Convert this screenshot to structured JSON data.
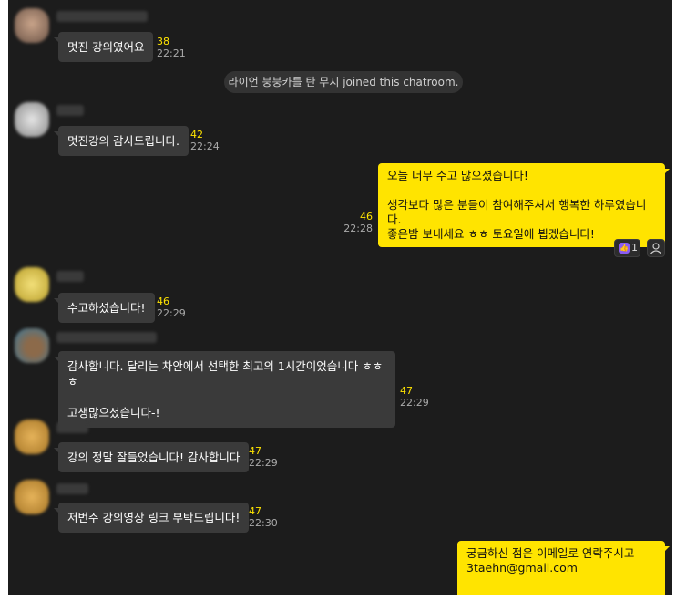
{
  "colors": {
    "background": "#1c1c1c",
    "incoming_bubble": "#3a3a3a",
    "outgoing_bubble": "#ffe400",
    "unread_count": "#ffe400",
    "timestamp": "#aaaaaa"
  },
  "messages": [
    {
      "text": "멋진 강의였어요",
      "count": "38",
      "time": "22:21"
    },
    {
      "text": "멋진강의 감사드립니다.",
      "count": "42",
      "time": "22:24"
    },
    {
      "text": "수고하셨습니다!",
      "count": "46",
      "time": "22:29"
    },
    {
      "text": "감사합니다. 달리는 차안에서 선택한 최고의 1시간이었습니다 ㅎㅎㅎ\n\n고생많으셨습니다-!",
      "count": "47",
      "time": "22:29"
    },
    {
      "text": "강의 정말 잘들었습니다! 감사합니다",
      "count": "47",
      "time": "22:29"
    },
    {
      "text": "저번주 강의영상 링크 부탁드립니다!",
      "count": "47",
      "time": "22:30"
    }
  ],
  "notice": "라이언 붕붕카를 탄 무지 joined this chatroom.",
  "my_messages": [
    {
      "text": "오늘 너무 수고 많으셨습니다!\n\n생각보다 많은 분들이 참여해주셔서 행복한 하루였습니다.\n좋은밤 보내세요 ㅎㅎ 토요일에 뵙겠습니다!",
      "count": "46",
      "time": "22:28"
    },
    {
      "text": "궁금하신 점은 이메일로 연락주시고\n3taehn@gmail.com"
    }
  ],
  "reaction": {
    "icon": "thumbs-up-icon",
    "count": "1"
  }
}
